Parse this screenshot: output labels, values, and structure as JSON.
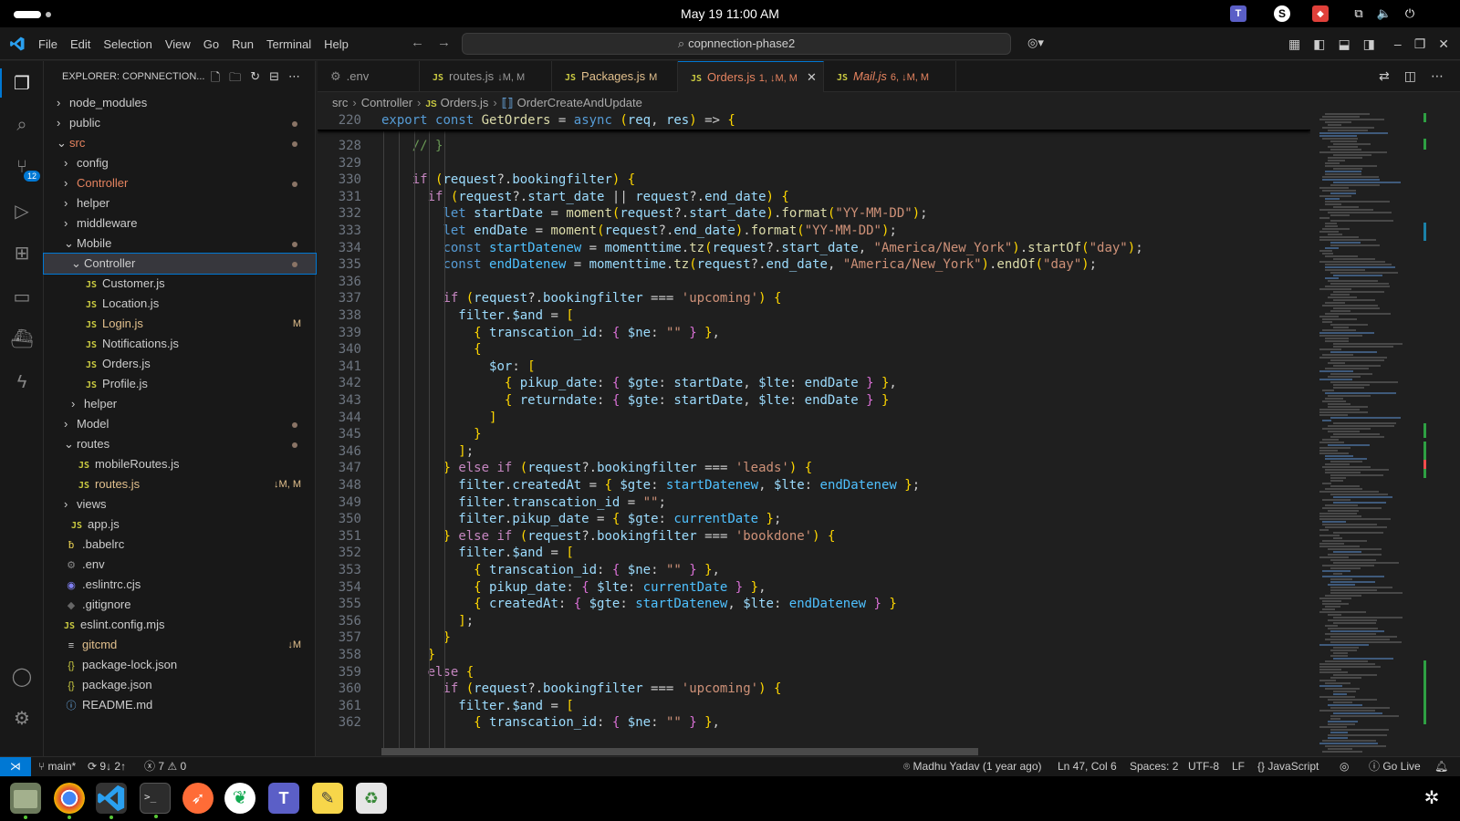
{
  "system": {
    "clock": "May 19  11:00 AM"
  },
  "menu": [
    "File",
    "Edit",
    "Selection",
    "View",
    "Go",
    "Run",
    "Terminal",
    "Help"
  ],
  "command_center": "copnnection-phase2",
  "explorer": {
    "title": "EXPLORER: COPNNECTION...",
    "items": [
      {
        "label": "node_modules",
        "depth": 0,
        "type": "folder",
        "open": false
      },
      {
        "label": "public",
        "depth": 0,
        "type": "folder",
        "open": false,
        "dot": true
      },
      {
        "label": "src",
        "depth": 0,
        "type": "folder",
        "open": true,
        "dot": true,
        "color": "red"
      },
      {
        "label": "config",
        "depth": 1,
        "type": "folder",
        "open": false
      },
      {
        "label": "Controller",
        "depth": 1,
        "type": "folder",
        "open": false,
        "dot": true,
        "color": "red"
      },
      {
        "label": "helper",
        "depth": 1,
        "type": "folder",
        "open": false
      },
      {
        "label": "middleware",
        "depth": 1,
        "type": "folder",
        "open": false
      },
      {
        "label": "Mobile",
        "depth": 1,
        "type": "folder",
        "open": true,
        "dot": true
      },
      {
        "label": "Controller",
        "depth": 2,
        "type": "folder",
        "open": true,
        "dot": true,
        "selected": true
      },
      {
        "label": "Customer.js",
        "depth": 3,
        "type": "js"
      },
      {
        "label": "Location.js",
        "depth": 3,
        "type": "js"
      },
      {
        "label": "Login.js",
        "depth": 3,
        "type": "js",
        "badge": "M",
        "color": "mod"
      },
      {
        "label": "Notifications.js",
        "depth": 3,
        "type": "js"
      },
      {
        "label": "Orders.js",
        "depth": 3,
        "type": "js"
      },
      {
        "label": "Profile.js",
        "depth": 3,
        "type": "js"
      },
      {
        "label": "helper",
        "depth": 2,
        "type": "folder",
        "open": false
      },
      {
        "label": "Model",
        "depth": 1,
        "type": "folder",
        "open": false,
        "dot": true
      },
      {
        "label": "routes",
        "depth": 1,
        "type": "folder",
        "open": true,
        "dot": true
      },
      {
        "label": "mobileRoutes.js",
        "depth": 2,
        "type": "js"
      },
      {
        "label": "routes.js",
        "depth": 2,
        "type": "js",
        "badge": "↓M, M",
        "color": "mod"
      },
      {
        "label": "views",
        "depth": 1,
        "type": "folder",
        "open": false
      },
      {
        "label": "app.js",
        "depth": 1,
        "type": "js"
      },
      {
        "label": ".babelrc",
        "depth": 0,
        "type": "babel"
      },
      {
        "label": ".env",
        "depth": 0,
        "type": "gear"
      },
      {
        "label": ".eslintrc.cjs",
        "depth": 0,
        "type": "eslint"
      },
      {
        "label": ".gitignore",
        "depth": 0,
        "type": "git"
      },
      {
        "label": "eslint.config.mjs",
        "depth": 0,
        "type": "js"
      },
      {
        "label": "gitcmd",
        "depth": 0,
        "type": "text",
        "badge": "↓M",
        "color": "mod"
      },
      {
        "label": "package-lock.json",
        "depth": 0,
        "type": "json"
      },
      {
        "label": "package.json",
        "depth": 0,
        "type": "json"
      },
      {
        "label": "README.md",
        "depth": 0,
        "type": "info"
      }
    ]
  },
  "tabs": [
    {
      "label": ".env",
      "icon": "gear",
      "mod": ""
    },
    {
      "label": "routes.js",
      "icon": "js",
      "mod": "↓M, M"
    },
    {
      "label": "Packages.js",
      "icon": "js",
      "mod": "M"
    },
    {
      "label": "Orders.js",
      "icon": "js",
      "mod": "1, ↓M, M",
      "active": true
    },
    {
      "label": "Mail.js",
      "icon": "js",
      "mod": "6, ↓M, M"
    }
  ],
  "breadcrumb": [
    "src",
    "Controller",
    "Orders.js",
    "OrderCreateAndUpdate"
  ],
  "editor": {
    "sticky": {
      "num": "220",
      "code": "export const GetOrders = async (req, res) => {"
    },
    "lines": [
      [
        "328",
        "    // }"
      ],
      [
        "329",
        ""
      ],
      [
        "330",
        "    if (request?.bookingfilter) {"
      ],
      [
        "331",
        "      if (request?.start_date || request?.end_date) {"
      ],
      [
        "332",
        "        let startDate = moment(request?.start_date).format(\"YY-MM-DD\");"
      ],
      [
        "333",
        "        let endDate = moment(request?.end_date).format(\"YY-MM-DD\");"
      ],
      [
        "334",
        "        const startDatenew = momenttime.tz(request?.start_date, \"America/New_York\").startOf(\"day\");"
      ],
      [
        "335",
        "        const endDatenew = momenttime.tz(request?.end_date, \"America/New_York\").endOf(\"day\");"
      ],
      [
        "336",
        ""
      ],
      [
        "337",
        "        if (request?.bookingfilter === 'upcoming') {"
      ],
      [
        "338",
        "          filter.$and = ["
      ],
      [
        "339",
        "            { transcation_id: { $ne: \"\" } },"
      ],
      [
        "340",
        "            {"
      ],
      [
        "341",
        "              $or: ["
      ],
      [
        "342",
        "                { pikup_date: { $gte: startDate, $lte: endDate } },"
      ],
      [
        "343",
        "                { returndate: { $gte: startDate, $lte: endDate } }"
      ],
      [
        "344",
        "              ]"
      ],
      [
        "345",
        "            }"
      ],
      [
        "346",
        "          ];"
      ],
      [
        "347",
        "        } else if (request?.bookingfilter === 'leads') {"
      ],
      [
        "348",
        "          filter.createdAt = { $gte: startDatenew, $lte: endDatenew };"
      ],
      [
        "349",
        "          filter.transcation_id = \"\";"
      ],
      [
        "350",
        "          filter.pikup_date = { $gte: currentDate };"
      ],
      [
        "351",
        "        } else if (request?.bookingfilter === 'bookdone') {"
      ],
      [
        "352",
        "          filter.$and = ["
      ],
      [
        "353",
        "            { transcation_id: { $ne: \"\" } },"
      ],
      [
        "354",
        "            { pikup_date: { $lte: currentDate } },"
      ],
      [
        "355",
        "            { createdAt: { $gte: startDatenew, $lte: endDatenew } }"
      ],
      [
        "356",
        "          ];"
      ],
      [
        "357",
        "        }"
      ],
      [
        "358",
        "      }"
      ],
      [
        "359",
        "      else {"
      ],
      [
        "360",
        "        if (request?.bookingfilter === 'upcoming') {"
      ],
      [
        "361",
        "          filter.$and = ["
      ],
      [
        "362",
        "            { transcation_id: { $ne: \"\" } },"
      ]
    ]
  },
  "status": {
    "branch": "main*",
    "sync": "9↓ 2↑",
    "problems": "7",
    "warnings": "0",
    "blame": "Madhu Yadav (1 year ago)",
    "position": "Ln 47, Col 6",
    "spaces": "Spaces: 2",
    "encoding": "UTF-8",
    "eol": "LF",
    "language": "JavaScript",
    "golive": "Go Live"
  },
  "colors": {
    "accent": "#0078d4",
    "modified": "#e2c08d",
    "error_folder": "#e5835f"
  }
}
